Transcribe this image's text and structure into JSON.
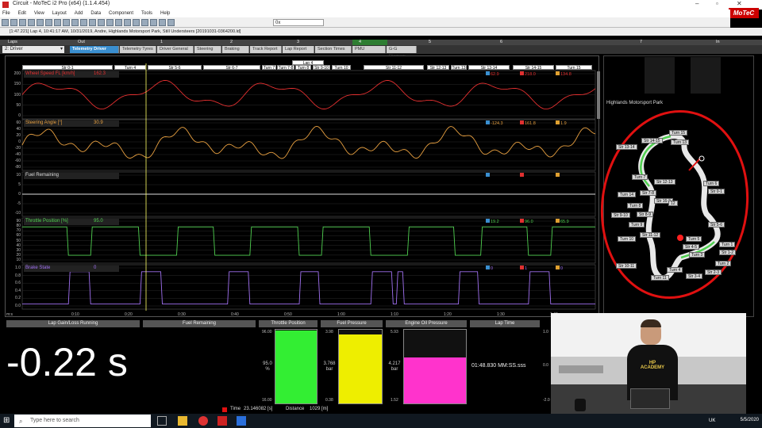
{
  "window": {
    "title": "Circuit - MoTeC i2 Pro (x64) (1.1.4.454)",
    "brand": "MoTeC"
  },
  "menu": [
    "File",
    "Edit",
    "View",
    "Layout",
    "Add",
    "Data",
    "Component",
    "Tools",
    "Help"
  ],
  "toolbar": {
    "zoom_value": "0x"
  },
  "status_line": "[1:47.221] Lap 4, 10:41:17 AM, 10/31/2019, Andre, Highlands Motorsport Park, Still Understeers [20191031-0364200.ld]",
  "lap_bar": {
    "title": "Laps",
    "labels": [
      "Out",
      "1",
      "2",
      "3",
      "4",
      "5",
      "6",
      "7",
      "In"
    ]
  },
  "worksheets": {
    "selected": "2: Driver",
    "tabs": [
      "Telemetry Driver",
      "Telemetry Tyres",
      "Driver General",
      "Steering",
      "Braking",
      "Track Report",
      "Lap Report",
      "Section Times",
      "PMU",
      "G-G Diagram"
    ]
  },
  "sections": {
    "lap_label": "Lap 4",
    "labels": [
      "Str 0-1",
      "Turn 4",
      "Str 5-6",
      "Str 6-7",
      "Turn 7",
      "Turn 7-8",
      "Turn 8",
      "Str 9-10",
      "Turn 10",
      "Str 11-12",
      "Str 12-13",
      "Turn 13",
      "Str 13-14",
      "Str 14-15",
      "Turn 15"
    ]
  },
  "plots": [
    {
      "name": "Wheel Speed FL [km/h]",
      "value": "162.3",
      "color": "#e53030",
      "ticks": [
        "200",
        "150",
        "100",
        "50",
        "0"
      ],
      "markers": [
        "62.9",
        "218.0",
        "134.8"
      ]
    },
    {
      "name": "Steering Angle [°]",
      "value": "30.9",
      "color": "#e8a040",
      "ticks": [
        "60",
        "40",
        "20",
        "0",
        "-20",
        "-40",
        "-60",
        "-80"
      ],
      "markers": [
        "-124.3",
        "161.8",
        "1.9"
      ]
    },
    {
      "name": "Fuel Remaining",
      "value": "",
      "color": "#dddddd",
      "ticks": [
        "10",
        "5",
        "0",
        "-5",
        "-10"
      ],
      "markers": [
        "",
        "",
        ""
      ]
    },
    {
      "name": "Throttle Position [%]",
      "value": "95.0",
      "color": "#50d050",
      "ticks": [
        "90",
        "80",
        "70",
        "60",
        "50",
        "40",
        "30",
        "20",
        "10"
      ],
      "markers": [
        "19.2",
        "96.0",
        "65.9"
      ]
    },
    {
      "name": "Brake State",
      "value": "0",
      "color": "#a070f0",
      "ticks": [
        "1.0",
        "0.8",
        "0.6",
        "0.4",
        "0.2",
        "0.0"
      ],
      "markers": [
        "0",
        "1",
        "0"
      ]
    }
  ],
  "time_axis": {
    "unit": "m:s",
    "ticks": [
      "0:10",
      "0:20",
      "0:30",
      "0:40",
      "0:50",
      "1:00",
      "1:10",
      "1:20",
      "1:30",
      "1:40"
    ]
  },
  "track": {
    "title": "Highlands Motorsport Park",
    "labels": [
      "Turn 15",
      "Str 14-15",
      "Turn 13",
      "Str 13-14",
      "Turn 7",
      "Str 12-13",
      "Turn 14",
      "Str 7-8",
      "Str 16-2",
      "Turn 8",
      "Str 9-10",
      "Turn 9",
      "Str 8-9",
      "Turn 6",
      "Str 0-1",
      "Str 5-6",
      "Turn 10",
      "Str 11-12",
      "Str 4-5",
      "Turn 5",
      "Turn 1",
      "Str 1-2",
      "Turn 3",
      "Turn 2",
      "Str 10-11",
      "Turn 4",
      "Str 2-3",
      "Turn 11",
      "Str 3-4",
      "12"
    ]
  },
  "gauges": {
    "lap_gain": {
      "title": "Lap Gain/Loss Running",
      "value": "-0.22 s"
    },
    "fuel": {
      "title": "Fuel Remaining"
    },
    "throttle": {
      "title": "Throttle Position",
      "max": "96.00",
      "min": "16.00",
      "value": "95.0",
      "unit": "%",
      "level": 0.99,
      "color": "#33ee33"
    },
    "fuel_pressure": {
      "title": "Fuel Pressure",
      "max": "3.98",
      "min": "0.38",
      "value": "3.768",
      "unit": "bar",
      "level": 0.94,
      "color": "#eeee00"
    },
    "oil_pressure": {
      "title": "Engine Oil Pressure",
      "max": "5.93",
      "min": "1.52",
      "value": "4.217",
      "unit": "bar",
      "level": 0.62,
      "color": "#ff33cc"
    },
    "lap_time": {
      "title": "Lap Time",
      "value": "01:48.830 MM:SS.sss"
    },
    "extra": {
      "values": [
        "1.0",
        "0.0",
        "-2.0"
      ]
    }
  },
  "bottom_info": {
    "time_label": "Time",
    "time_value": "23.146082 [s]",
    "distance_label": "Distance",
    "distance_value": "1029 [m]"
  },
  "webcam": {
    "shirt_text": "HP ACADEMY"
  },
  "taskbar": {
    "search_placeholder": "Type here to search",
    "locale": "UK",
    "date": "5/5/2020"
  }
}
